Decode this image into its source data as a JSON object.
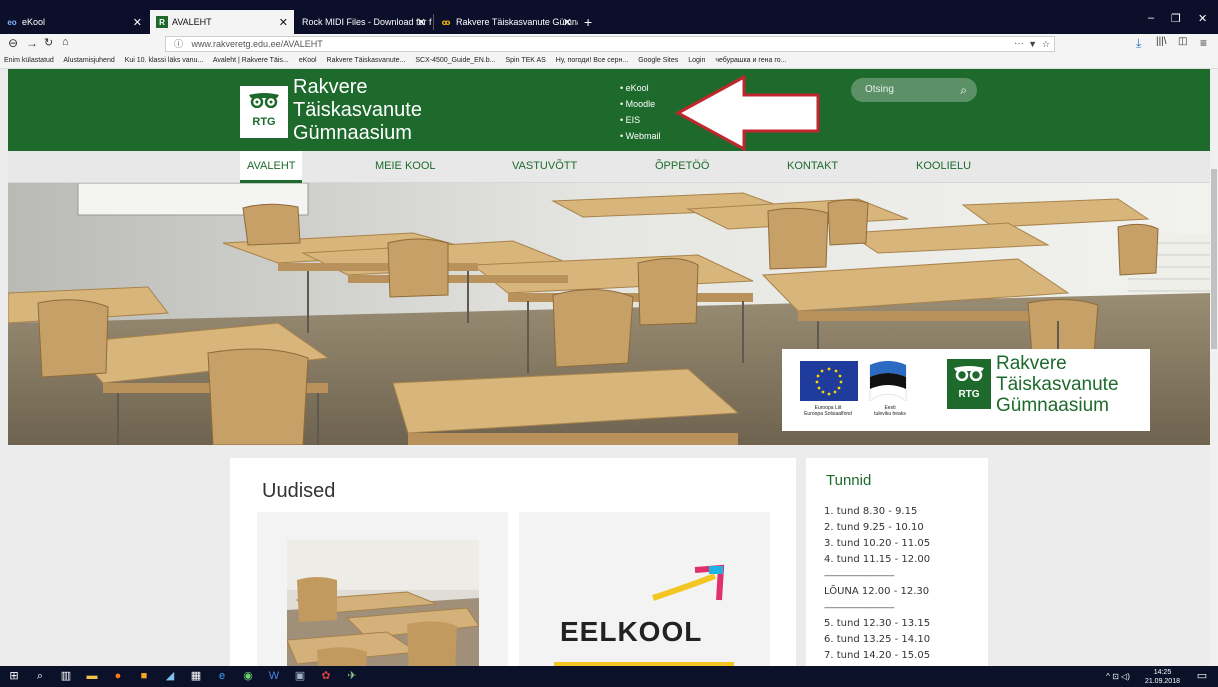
{
  "browser": {
    "tabs": [
      {
        "label": "eKool",
        "icon": "ekool-favicon"
      },
      {
        "label": "AVALEHT",
        "icon": "rtg-favicon"
      },
      {
        "label": "Rock MIDI Files - Download for free",
        "icon": ""
      },
      {
        "label": "Rakvere Täiskasvanute Gümnaa",
        "icon": "rtg-owl-favicon"
      }
    ],
    "new_tab": "+",
    "url_value": "www.rakveretg.edu.ee/AVALEHT",
    "url_info": "ⓘ",
    "url_more": "···",
    "bookmarks": [
      "Enim külastatud",
      "Alustamisjuhend",
      "Kui 10. klassi läks vanu...",
      "Avaleht | Rakvere Täis...",
      "eKool",
      "Rakvere Täiskasvanute...",
      "SCX-4500_Guide_EN.b...",
      "Spin TEK AS",
      "Ну, погоди! Все серн...",
      "Google Sites",
      "Login",
      "чебурашка и гена го..."
    ]
  },
  "site": {
    "logo": {
      "badge": "RTG",
      "line1": "Rakvere",
      "line2": "Täiskasvanute",
      "line3": "Gümnaasium"
    },
    "quick_links": [
      "• eKool",
      "• Moodle",
      "• EIS",
      "• Webmail"
    ],
    "search_placeholder": "Otsing",
    "menu": [
      "AVALEHT",
      "MEIE KOOL",
      "VASTUVÕTT",
      "ÕPPETÖÖ",
      "KONTAKT",
      "KOOLIELU"
    ],
    "hero_badges": {
      "eu_caption1": "Euroopa Liit",
      "eu_caption2": "Euroopa Sotsiaalfond",
      "ee_caption1": "Eesti",
      "ee_caption2": "tuleviku heaks",
      "logo_badge": "RTG",
      "logo_line1": "Rakvere",
      "logo_line2": "Täiskasvanute",
      "logo_line3": "Gümnaasium"
    },
    "news_title": "Uudised",
    "news_card2_text": "EELKOOL",
    "lessons": {
      "title": "Tunnid",
      "rows": [
        "1. tund   8.30 - 9.15",
        "2. tund   9.25 - 10.10",
        "3. tund  10.20 - 11.05",
        "4. tund  11.15 - 12.00",
        "-------------------------------------",
        "LÕUNA  12.00 - 12.30",
        "-------------------------------------",
        "5. tund  12.30 - 13.15",
        "6. tund  13.25 - 14.10",
        "7. tund  14.20 - 15.05"
      ]
    }
  },
  "taskbar": {
    "time": "14:25",
    "date": "21.09.2018"
  },
  "colors": {
    "brand_green": "#1d6a2c",
    "tabbar": "#0c0f2a",
    "taskbar": "#0b1129",
    "arrow_red": "#c0272d"
  }
}
